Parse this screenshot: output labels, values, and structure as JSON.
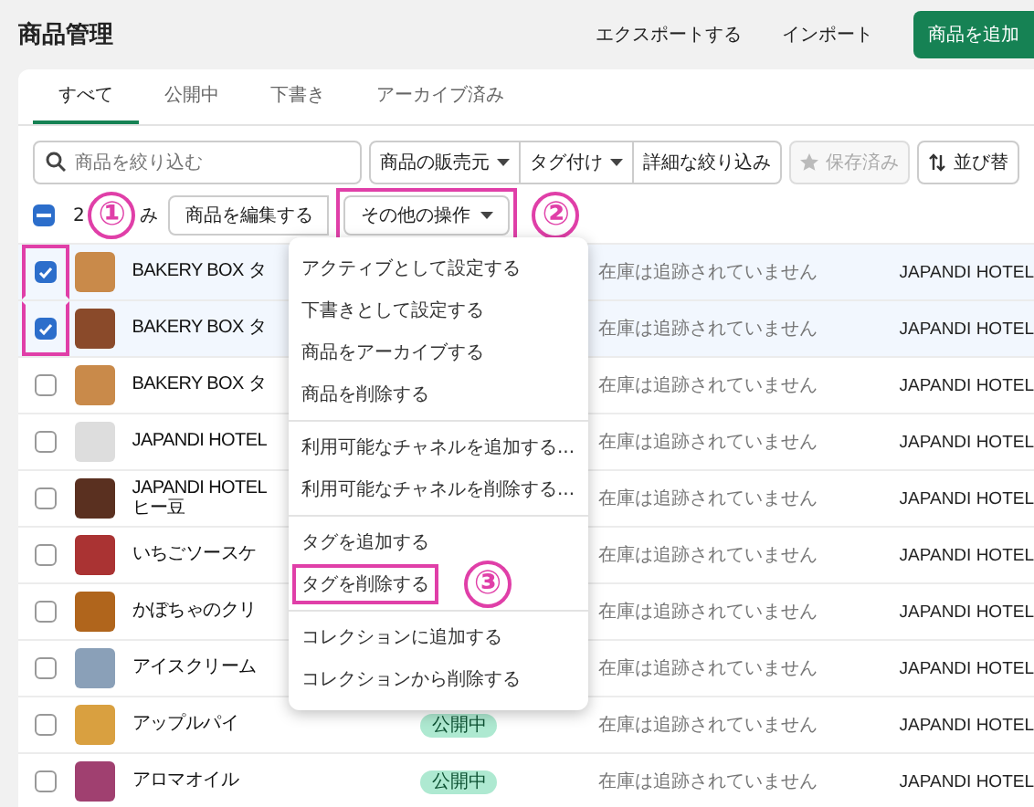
{
  "page": {
    "title": "商品管理",
    "actions": [
      {
        "label": "エクスポートする",
        "kind": "link"
      },
      {
        "label": "インポート",
        "kind": "link"
      },
      {
        "label": "商品を追加",
        "kind": "primary"
      }
    ]
  },
  "tabs": [
    {
      "label": "すべて",
      "selected": true
    },
    {
      "label": "公開中",
      "selected": false
    },
    {
      "label": "下書き",
      "selected": false
    },
    {
      "label": "アーカイブ済み",
      "selected": false
    }
  ],
  "filters": {
    "search": {
      "placeholder": "商品を絞り込む"
    },
    "buttons": [
      {
        "label": "商品の販売元",
        "kind": "dropdown"
      },
      {
        "label": "タグ付け",
        "kind": "dropdown"
      },
      {
        "label": "詳細な絞り込み",
        "kind": "plain"
      }
    ],
    "saved": {
      "label": "保存済み",
      "disabled": true
    },
    "sort": {
      "label": "並び替"
    }
  },
  "bulk_bar": {
    "indeterminate": true,
    "count": "2",
    "count_rest": "み",
    "buttons": [
      {
        "label": "商品を編集する",
        "dropdown": false,
        "highlighted": false
      },
      {
        "label": "その他の操作",
        "dropdown": true,
        "highlighted": true
      }
    ]
  },
  "rows": [
    {
      "name": [
        "BAKERY BOX タ"
      ],
      "selected": true,
      "highlighted": true,
      "inventory": "在庫は追跡されていません",
      "vendor": "JAPANDI HOTEL"
    },
    {
      "name": [
        "BAKERY BOX タ"
      ],
      "selected": true,
      "highlighted": true,
      "inventory": "在庫は追跡されていません",
      "vendor": "JAPANDI HOTEL"
    },
    {
      "name": [
        "BAKERY BOX タ"
      ],
      "selected": false,
      "highlighted": false,
      "inventory": "在庫は追跡されていません",
      "vendor": "JAPANDI HOTEL"
    },
    {
      "name": [
        "JAPANDI HOTEL"
      ],
      "selected": false,
      "highlighted": false,
      "inventory": "在庫は追跡されていません",
      "vendor": "JAPANDI HOTEL"
    },
    {
      "name": [
        "JAPANDI HOTEL",
        "ヒー豆"
      ],
      "selected": false,
      "highlighted": false,
      "inventory": "在庫は追跡されていません",
      "vendor": "JAPANDI HOTEL"
    },
    {
      "name": [
        "いちごソースケ"
      ],
      "selected": false,
      "highlighted": false,
      "inventory": "在庫は追跡されていません",
      "vendor": "JAPANDI HOTEL"
    },
    {
      "name": [
        "かぼちゃのクリ"
      ],
      "selected": false,
      "highlighted": false,
      "inventory": "在庫は追跡されていません",
      "vendor": "JAPANDI HOTEL"
    },
    {
      "name": [
        "アイスクリーム"
      ],
      "selected": false,
      "highlighted": false,
      "inventory": "在庫は追跡されていません",
      "vendor": "JAPANDI HOTEL"
    },
    {
      "name": [
        "アップルパイ"
      ],
      "selected": false,
      "highlighted": false,
      "status": "公開中",
      "inventory": "在庫は追跡されていません",
      "vendor": "JAPANDI HOTEL"
    },
    {
      "name": [
        "アロマオイル"
      ],
      "selected": false,
      "highlighted": false,
      "status": "公開中",
      "inventory": "在庫は追跡されていません",
      "vendor": "JAPANDI HOTEL"
    }
  ],
  "menu": {
    "groups": [
      [
        {
          "label": "アクティブとして設定する",
          "highlighted": false
        },
        {
          "label": "下書きとして設定する",
          "highlighted": false
        },
        {
          "label": "商品をアーカイブする",
          "highlighted": false
        },
        {
          "label": "商品を削除する",
          "highlighted": false
        }
      ],
      [
        {
          "label": "利用可能なチャネルを追加する...",
          "highlighted": false
        },
        {
          "label": "利用可能なチャネルを削除する...",
          "highlighted": false
        }
      ],
      [
        {
          "label": "タグを追加する",
          "highlighted": false
        },
        {
          "label": "タグを削除する",
          "highlighted": true
        }
      ],
      [
        {
          "label": "コレクションに追加する",
          "highlighted": false
        },
        {
          "label": "コレクションから削除する",
          "highlighted": false
        }
      ]
    ]
  },
  "annotations": [
    {
      "number": "①"
    },
    {
      "number": "②"
    },
    {
      "number": "③"
    }
  ]
}
